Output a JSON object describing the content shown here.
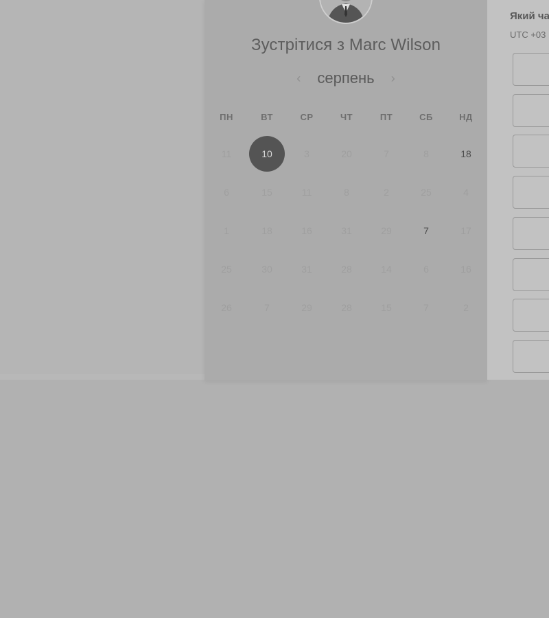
{
  "calendar": {
    "title": "Зустрітися з Marc Wilson",
    "month": "серпень",
    "prev_icon": "‹",
    "next_icon": "›",
    "weekdays": [
      "ПН",
      "ВТ",
      "СР",
      "ЧТ",
      "ПТ",
      "СБ",
      "НД"
    ],
    "weeks": [
      [
        "11",
        "10",
        "3",
        "20",
        "7",
        "8",
        "18"
      ],
      [
        "6",
        "15",
        "11",
        "8",
        "2",
        "25",
        "4"
      ],
      [
        "1",
        "18",
        "16",
        "31",
        "29",
        "7",
        "17"
      ],
      [
        "25",
        "30",
        "31",
        "28",
        "14",
        "6",
        "16"
      ],
      [
        "26",
        "7",
        "29",
        "28",
        "15",
        "7",
        "2"
      ]
    ],
    "selected_day": "10",
    "available_days": [
      "18",
      "7"
    ]
  },
  "time_panel": {
    "heading": "Який ча",
    "timezone": "UTC +03",
    "slot_count": 8
  },
  "colors": {
    "backdrop": "#b1b1b1",
    "selected": "#545454"
  }
}
